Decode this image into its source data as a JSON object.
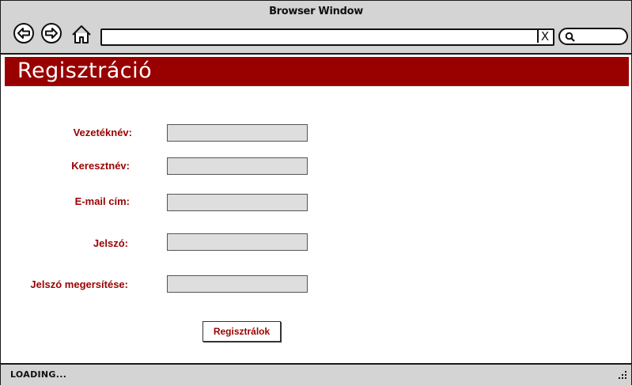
{
  "window": {
    "title": "Browser Window"
  },
  "toolbar": {
    "back_icon": "back-arrow-icon",
    "forward_icon": "forward-arrow-icon",
    "home_icon": "home-icon",
    "url_value": "",
    "clear_label": "X",
    "search_value": ""
  },
  "page": {
    "title": "Regisztráció"
  },
  "form": {
    "fields": [
      {
        "label": "Vezetéknév:",
        "value": ""
      },
      {
        "label": "Keresztnév:",
        "value": ""
      },
      {
        "label": "E-mail cím:",
        "value": ""
      },
      {
        "label": "Jelszó:",
        "value": ""
      },
      {
        "label": "Jelszó megersítése:",
        "value": ""
      }
    ],
    "submit_label": "Regisztrálok"
  },
  "status": {
    "text": "LOADING..."
  },
  "colors": {
    "accent": "#990000",
    "chrome": "#d4d4d4",
    "input_bg": "#dedede"
  }
}
